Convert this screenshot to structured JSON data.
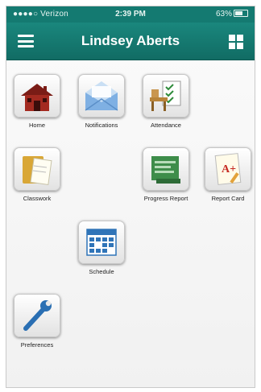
{
  "status_bar": {
    "carrier": "●●●●○ Verizon",
    "time": "2:39 PM",
    "battery": "63%"
  },
  "nav": {
    "title": "Lindsey Aberts",
    "menu_icon": "menu-icon",
    "grid_icon": "grid-icon"
  },
  "tiles": {
    "home": {
      "label": "Home",
      "icon": "house-icon"
    },
    "notifications": {
      "label": "Notifications",
      "icon": "envelope-icon"
    },
    "attendance": {
      "label": "Attendance",
      "icon": "desk-checklist-icon"
    },
    "classwork": {
      "label": "Classwork",
      "icon": "folder-paper-icon"
    },
    "progress_report": {
      "label": "Progress Report",
      "icon": "progress-report-icon"
    },
    "report_card": {
      "label": "Report Card",
      "icon": "graded-paper-icon"
    },
    "schedule": {
      "label": "Schedule",
      "icon": "calendar-icon"
    },
    "preferences": {
      "label": "Preferences",
      "icon": "wrench-icon"
    }
  },
  "colors": {
    "header": "#147a71",
    "text": "#222222"
  }
}
